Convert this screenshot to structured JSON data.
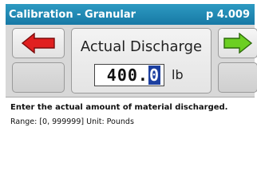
{
  "header": {
    "title": "Calibration - Granular",
    "page": "p 4.009"
  },
  "field": {
    "label": "Actual Discharge",
    "value_prefix": "400.",
    "value_cursor": "0",
    "unit": "lb"
  },
  "nav": {
    "prev_icon": "left-arrow-icon",
    "next_icon": "right-arrow-icon"
  },
  "info": {
    "description": "Enter the actual amount of material discharged.",
    "range_text": "Range: [0, 999999]  Unit: Pounds"
  },
  "colors": {
    "title_bar": "#1f8ab5",
    "prev_arrow": "#e02020",
    "next_arrow": "#6ccf22",
    "cursor_highlight": "#1c3fa0"
  }
}
